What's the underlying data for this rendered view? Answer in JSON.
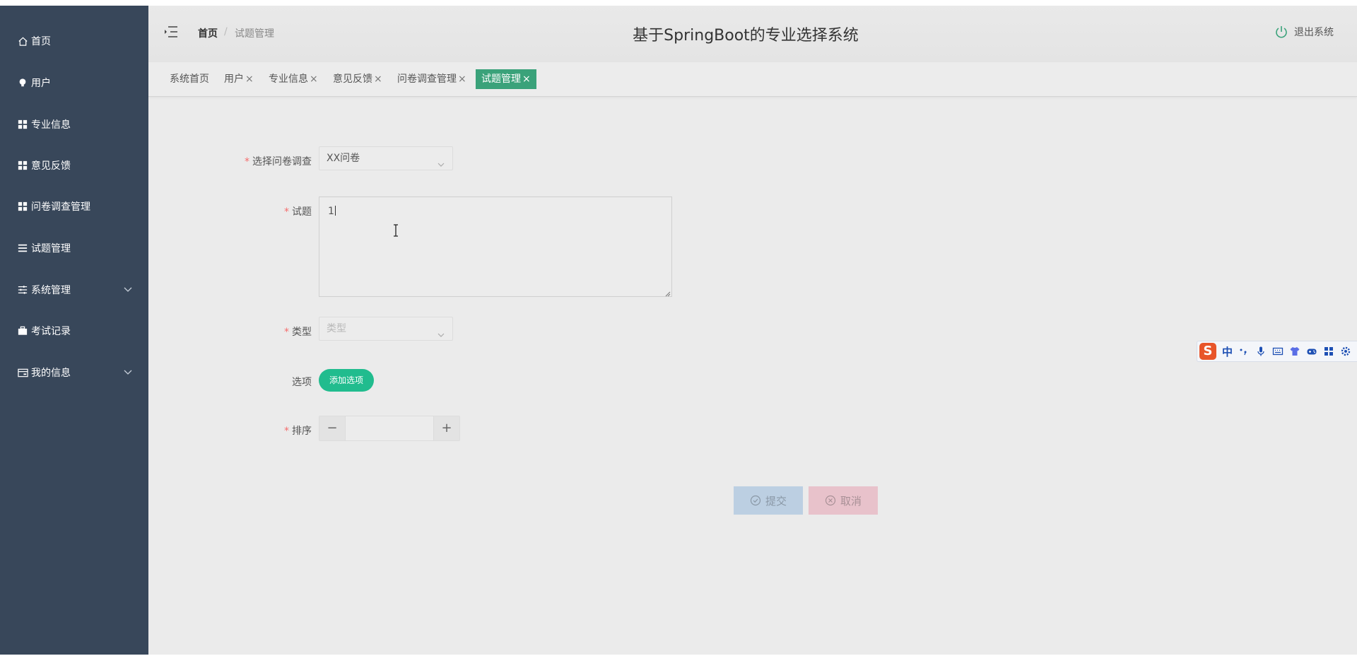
{
  "sidebar": {
    "items": [
      {
        "label": "首页",
        "icon": "home-icon"
      },
      {
        "label": "用户",
        "icon": "bulb-icon"
      },
      {
        "label": "专业信息",
        "icon": "grid-icon"
      },
      {
        "label": "意见反馈",
        "icon": "grid-icon"
      },
      {
        "label": "问卷调查管理",
        "icon": "grid-icon"
      },
      {
        "label": "试题管理",
        "icon": "list-icon"
      },
      {
        "label": "系统管理",
        "icon": "sliders-icon",
        "expandable": true
      },
      {
        "label": "考试记录",
        "icon": "briefcase-icon"
      },
      {
        "label": "我的信息",
        "icon": "card-icon",
        "expandable": true
      }
    ]
  },
  "header": {
    "breadcrumb_home": "首页",
    "breadcrumb_sep": "/",
    "breadcrumb_current": "试题管理",
    "title": "基于SpringBoot的专业选择系统",
    "logout_label": "退出系统"
  },
  "tabs": [
    {
      "label": "系统首页",
      "closable": false,
      "active": false
    },
    {
      "label": "用户",
      "closable": true,
      "active": false
    },
    {
      "label": "专业信息",
      "closable": true,
      "active": false
    },
    {
      "label": "意见反馈",
      "closable": true,
      "active": false
    },
    {
      "label": "问卷调查管理",
      "closable": true,
      "active": false
    },
    {
      "label": "试题管理",
      "closable": true,
      "active": true
    }
  ],
  "tab_close_glyph": "×",
  "form": {
    "survey_label": "选择问卷调查",
    "survey_value": "XX问卷",
    "question_label": "试题",
    "question_value": "1",
    "type_label": "类型",
    "type_placeholder": "类型",
    "options_label": "选项",
    "add_option_label": "添加选项",
    "sort_label": "排序",
    "sort_value": "",
    "required_mark": "*",
    "stepper_minus": "−",
    "stepper_plus": "+"
  },
  "actions": {
    "submit_label": "提交",
    "cancel_label": "取消"
  },
  "ime": {
    "logo": "S",
    "mode": "中"
  },
  "colors": {
    "sidebar_bg": "#38475a",
    "active_tab": "#3aa27a",
    "add_option_btn": "#21bc8e",
    "submit_btn": "#bccfe2",
    "cancel_btn": "#e8c2cb",
    "required": "#f56c6c"
  }
}
